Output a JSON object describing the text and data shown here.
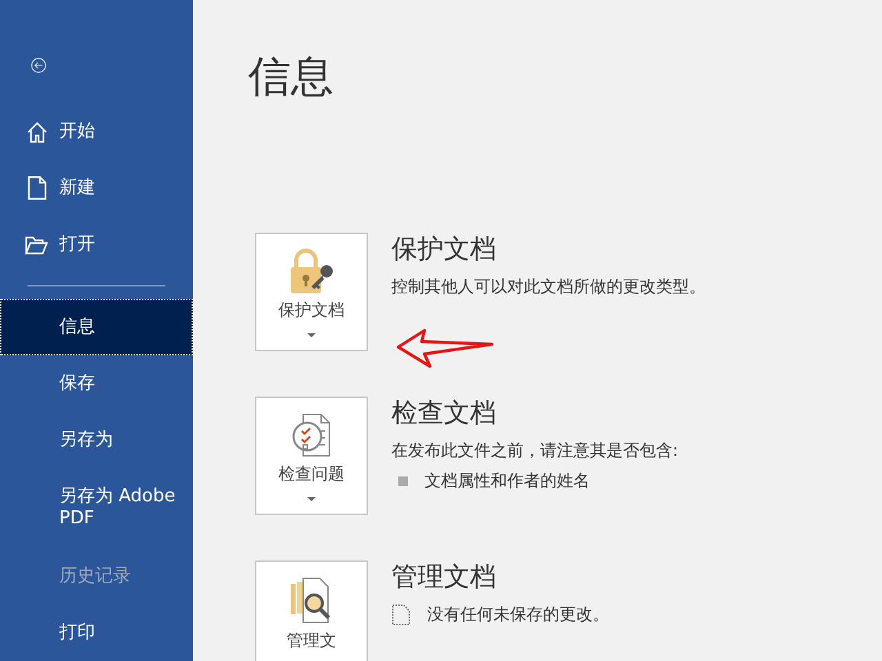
{
  "sidebar": {
    "nav_top": [
      {
        "label": "开始",
        "selected": false,
        "disabled": false
      },
      {
        "label": "新建",
        "selected": false,
        "disabled": false
      },
      {
        "label": "打开",
        "selected": false,
        "disabled": false
      }
    ],
    "nav_bottom": [
      {
        "label": "信息",
        "selected": true,
        "disabled": false
      },
      {
        "label": "保存",
        "selected": false,
        "disabled": false
      },
      {
        "label": "另存为",
        "selected": false,
        "disabled": false
      },
      {
        "label": "另存为 Adobe PDF",
        "selected": false,
        "disabled": false
      },
      {
        "label": "历史记录",
        "selected": false,
        "disabled": true
      },
      {
        "label": "打印",
        "selected": false,
        "disabled": false
      }
    ]
  },
  "page_title": "信息",
  "sections": [
    {
      "button": "保护文档",
      "title": "保护文档",
      "lines": [
        {
          "kind": "text",
          "text": "控制其他人可以对此文档所做的更改类型。"
        }
      ]
    },
    {
      "button": "检查问题",
      "title": "检查文档",
      "lines": [
        {
          "kind": "text",
          "text": "在发布此文件之前，请注意其是否包含:"
        },
        {
          "kind": "bullet",
          "text": "文档属性和作者的姓名"
        }
      ]
    },
    {
      "button": "管理文",
      "title": "管理文档",
      "lines": [
        {
          "kind": "note",
          "text": "没有任何未保存的更改。"
        }
      ]
    }
  ]
}
